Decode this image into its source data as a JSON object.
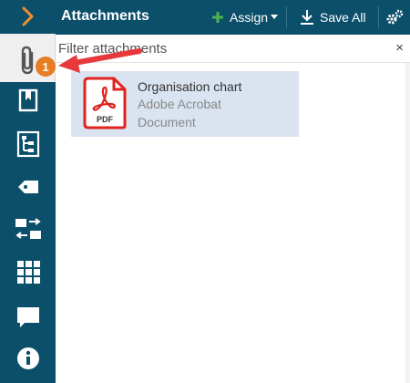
{
  "header": {
    "title": "Attachments",
    "assign_label": "Assign",
    "save_all_label": "Save All"
  },
  "filter": {
    "placeholder": "Filter attachments",
    "clear_glyph": "×"
  },
  "attachments": [
    {
      "name": "Organisation chart",
      "type_line1": "Adobe Acrobat",
      "type_line2": "Document",
      "icon": "pdf-icon",
      "icon_label": "PDF"
    }
  ],
  "annotation": {
    "badge": "1",
    "badge_color": "#e87d23",
    "arrow_color": "#e8383b"
  },
  "rail": {
    "icons": [
      "chevron-right-icon",
      "paperclip-icon",
      "bookmark-icon",
      "tree-icon",
      "tag-icon",
      "transfer-icon",
      "grid-icon",
      "comment-icon",
      "info-icon"
    ],
    "selected": "paperclip-icon"
  },
  "colors": {
    "brand": "#0c4f6b",
    "selection": "#dae3f0",
    "assign_plus": "#4db24f",
    "chevron": "#f08d2f"
  }
}
